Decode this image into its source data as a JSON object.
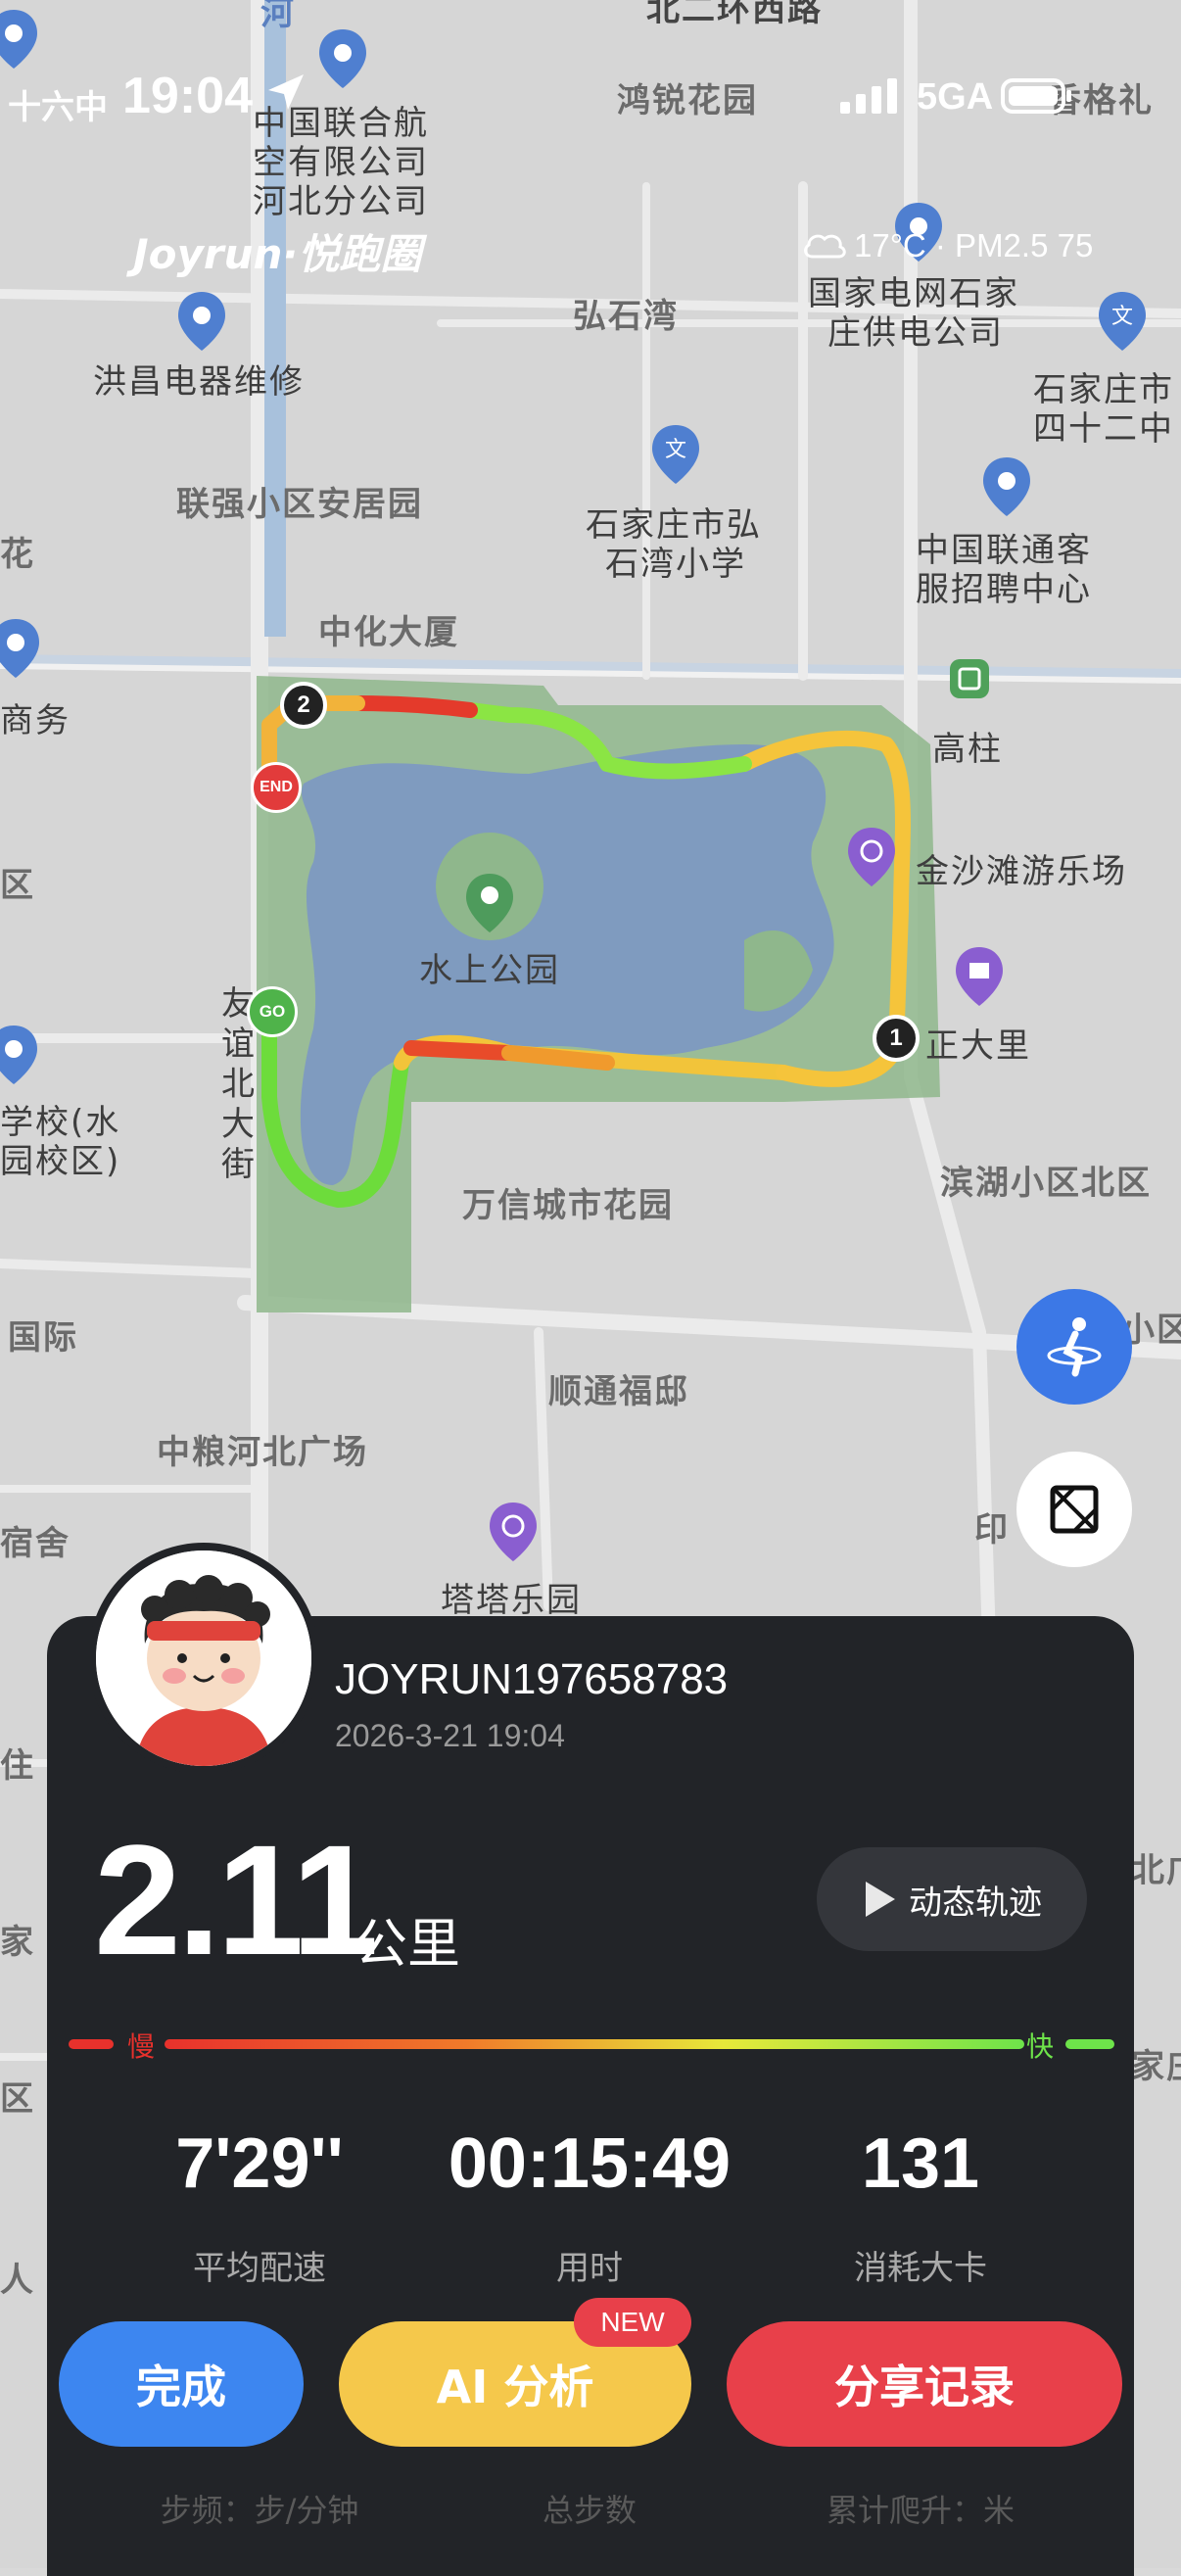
{
  "status_bar": {
    "time": "19:04",
    "left_fragment": "十六中",
    "network": "5GA"
  },
  "brand": "Joyrun·悦跑圈",
  "weather": "17°C · PM2.5 75",
  "map_labels": {
    "top_road": "北二环西路",
    "hongrui": "鸿锐花园",
    "gege": "香格礼",
    "airline": "中国联合航空有限公司河北分公司",
    "airline_l1": "中国联合航",
    "airline_l2": "空有限公司",
    "airline_l3": "河北分公司",
    "hongshiwan": "弘石湾",
    "grid_l1": "国家电网石家",
    "grid_l2": "庄供电公司",
    "hongchang": "洪昌电器维修",
    "sjz_l1": "石家庄市",
    "sjz_l2": "四十二中",
    "lianqiang": "联强小区安居园",
    "school_l1": "石家庄市弘",
    "school_l2": "石湾小学",
    "unicom_l1": "中国联通客",
    "unicom_l2": "服招聘中心",
    "zhonghua": "中化大厦",
    "shangwu": "商务",
    "gaozhu": "高柱",
    "jinsha": "金沙滩游乐场",
    "park": "水上公园",
    "zhengda": "正大里",
    "youyi": "友谊北大街",
    "xuexiao_l1": "学校(水",
    "xuexiao_l2": "园校区)",
    "wanxin": "万信城市花园",
    "binhu": "滨湖小区北区",
    "guoji": "国际",
    "shuntong": "顺通福邸",
    "xiaoquan": "小区",
    "zhongliang": "中粮河北广场",
    "sushe": "宿舍",
    "tata": "塔塔乐园",
    "yin": "印",
    "zhu": "住",
    "jia": "家",
    "jia2": "家庄",
    "bei": "北广",
    "qu": "区",
    "ren": "人",
    "hua": "花",
    "qu2": "区",
    "he": "河"
  },
  "route_markers": {
    "start": "GO",
    "end": "END",
    "km1": "1",
    "km2": "2"
  },
  "user": {
    "name": "JOYRUN197658783",
    "datetime": "2026-3-21 19:04"
  },
  "distance": {
    "value": "2.11",
    "unit": "公里"
  },
  "dynamic_track_label": "动态轨迹",
  "speed_legend": {
    "slow": "慢",
    "fast": "快"
  },
  "stats": [
    {
      "value": "7'29''",
      "label": "平均配速"
    },
    {
      "value": "00:15:49",
      "label": "用时"
    },
    {
      "value": "131",
      "label": "消耗大卡"
    }
  ],
  "buttons": {
    "done": "完成",
    "ai": "AI 分析",
    "ai_badge": "NEW",
    "share": "分享记录"
  },
  "bottom_stats": {
    "cadence": "步频：步/分钟",
    "steps": "总步数",
    "climb": "累计爬升：米"
  },
  "colors": {
    "done": "#3d86f0",
    "ai": "#f5c84b",
    "share": "#e8404a",
    "card": "#222428",
    "badge": "#e8404a"
  }
}
